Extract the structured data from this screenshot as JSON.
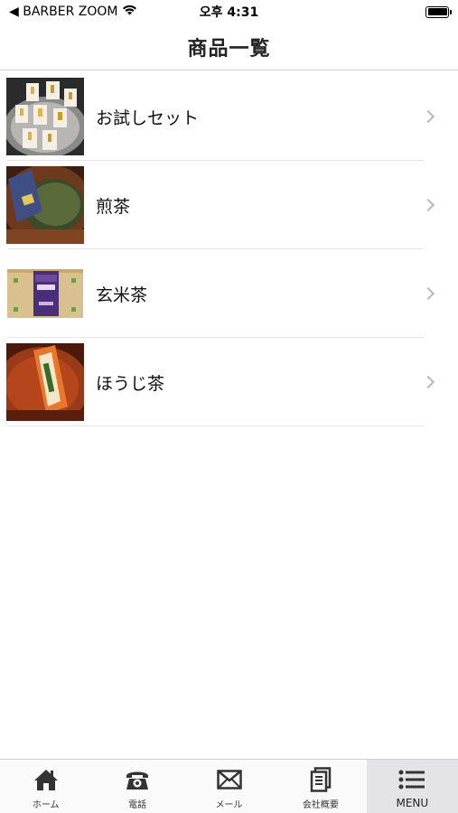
{
  "status_bar": {
    "carrier": "◀ BARBER ZOOM",
    "time": "오후 4:31"
  },
  "header": {
    "title": "商品一覧"
  },
  "products": [
    {
      "label": "お試しセット",
      "image": "tea-sample-set-photo"
    },
    {
      "label": "煎茶",
      "image": "sencha-tea-photo"
    },
    {
      "label": "玄米茶",
      "image": "genmaicha-box-photo"
    },
    {
      "label": "ほうじ茶",
      "image": "hojicha-pack-photo"
    }
  ],
  "tabs": [
    {
      "label": "ホーム",
      "icon": "home-icon"
    },
    {
      "label": "電話",
      "icon": "phone-icon"
    },
    {
      "label": "メール",
      "icon": "mail-icon"
    },
    {
      "label": "会社概要",
      "icon": "document-icon"
    },
    {
      "label": "MENU",
      "icon": "menu-icon",
      "active": true
    }
  ]
}
